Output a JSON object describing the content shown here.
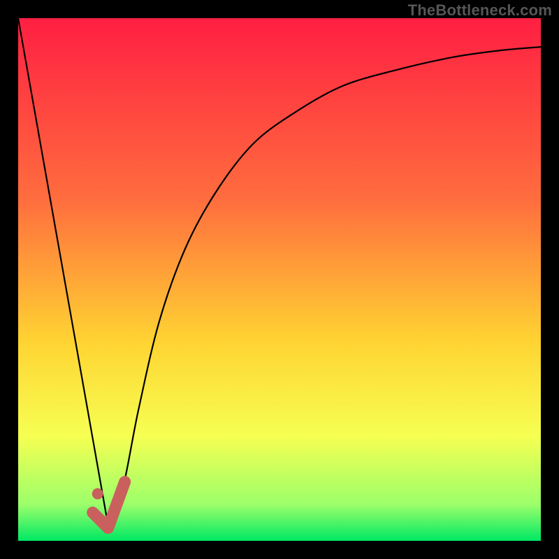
{
  "watermark": "TheBottleneck.com",
  "colors": {
    "gradient_top": "#ff1f42",
    "gradient_upper": "#ff6e3e",
    "gradient_mid": "#ffd432",
    "gradient_lower": "#f6ff52",
    "gradient_green_light": "#9cff6a",
    "gradient_green": "#00e864",
    "curve": "#000000",
    "marker": "#c9605d",
    "marker_dot": "#c9605d"
  },
  "chart_data": {
    "type": "line",
    "title": "",
    "xlabel": "",
    "ylabel": "",
    "xlim": [
      0,
      100
    ],
    "ylim": [
      0,
      100
    ],
    "series": [
      {
        "name": "bottleneck-curve-left",
        "x": [
          0,
          17.2
        ],
        "y": [
          100,
          3
        ]
      },
      {
        "name": "bottleneck-curve-right",
        "x": [
          17.2,
          20,
          23,
          27,
          32,
          38,
          45,
          53,
          62,
          72,
          83,
          92,
          100
        ],
        "y": [
          3,
          10,
          25,
          42,
          56,
          67,
          76,
          82,
          87,
          90,
          92.5,
          93.8,
          94.5
        ]
      }
    ],
    "marker": {
      "name": "optimal-check",
      "x": 17.2,
      "y": 3,
      "dot_x": 15.2,
      "dot_y": 9
    }
  }
}
